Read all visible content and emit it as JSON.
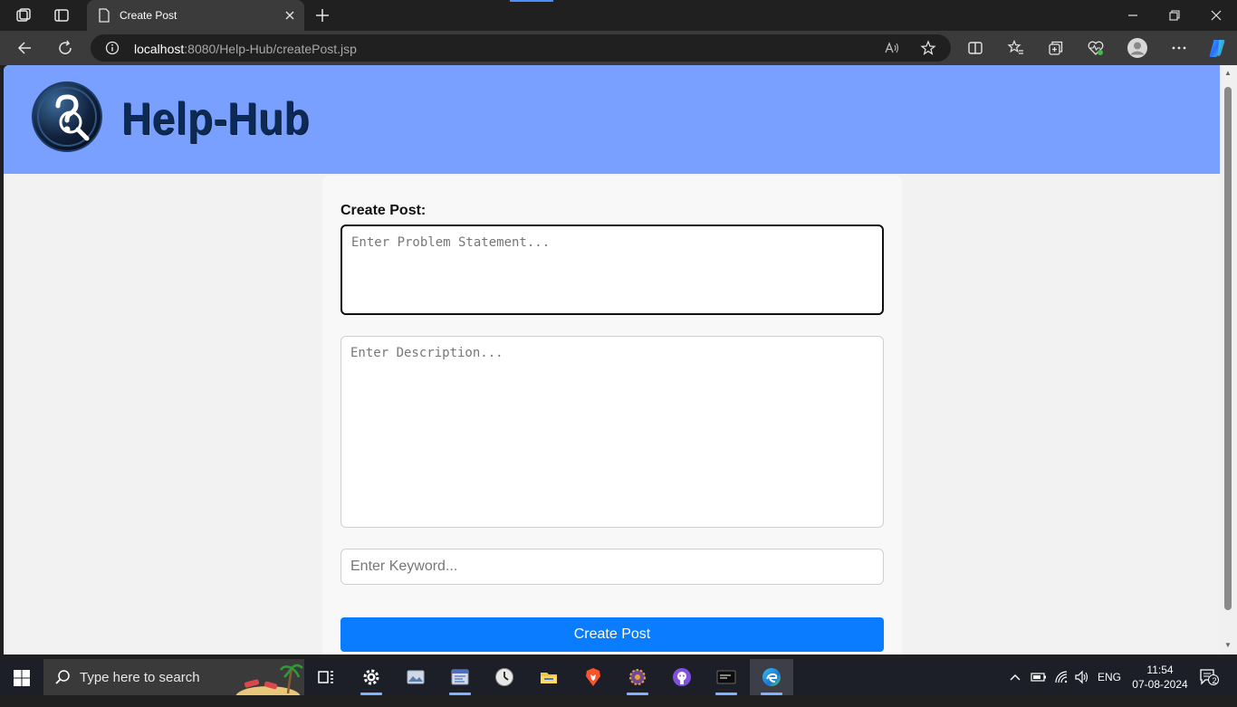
{
  "browser": {
    "tab_title": "Create Post",
    "url_host": "localhost",
    "url_rest": ":8080/Help-Hub/createPost.jsp"
  },
  "site": {
    "brand": "Help-Hub"
  },
  "form": {
    "label": "Create Post:",
    "problem_placeholder": "Enter Problem Statement...",
    "description_placeholder": "Enter Description...",
    "keyword_placeholder": "Enter Keyword...",
    "submit_label": "Create Post"
  },
  "taskbar": {
    "search_placeholder": "Type here to search",
    "language": "ENG",
    "time": "11:54",
    "date": "07-08-2024",
    "notifications": "2"
  },
  "colors": {
    "header": "#79a0ff",
    "brand_text": "#0d2a55",
    "button": "#0a7cff"
  }
}
